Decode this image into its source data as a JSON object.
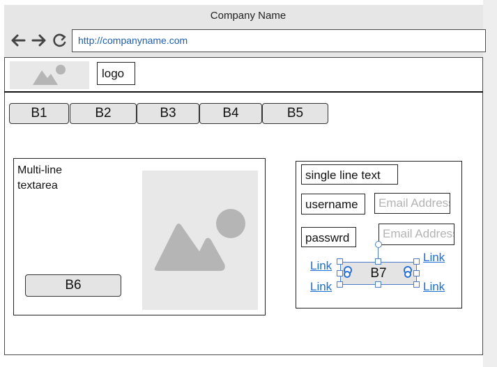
{
  "window": {
    "title": "Company Name"
  },
  "browser": {
    "url": "http://companyname.com"
  },
  "header": {
    "logo_label": "logo"
  },
  "tabs": [
    {
      "label": "B1"
    },
    {
      "label": "B2"
    },
    {
      "label": "B3"
    },
    {
      "label": "B4"
    },
    {
      "label": "B5"
    }
  ],
  "left_panel": {
    "textarea_line1": "Multi-line",
    "textarea_line2": "textarea",
    "button_label": "B6"
  },
  "form": {
    "single_line_label": "single line text",
    "username_label": "username",
    "username_placeholder": "Email Address",
    "password_label": "passwrd",
    "password_placeholder": "Email Address",
    "button_label": "B7",
    "links": [
      "Link",
      "Link",
      "Link",
      "Link"
    ]
  },
  "icons": {
    "back": "arrow-left-icon",
    "forward": "arrow-right-icon",
    "reload": "reload-icon",
    "image": "image-placeholder-icon"
  },
  "colors": {
    "link": "#1a6fd6",
    "url": "#1a5fb4",
    "selection": "#4a7cc9"
  }
}
